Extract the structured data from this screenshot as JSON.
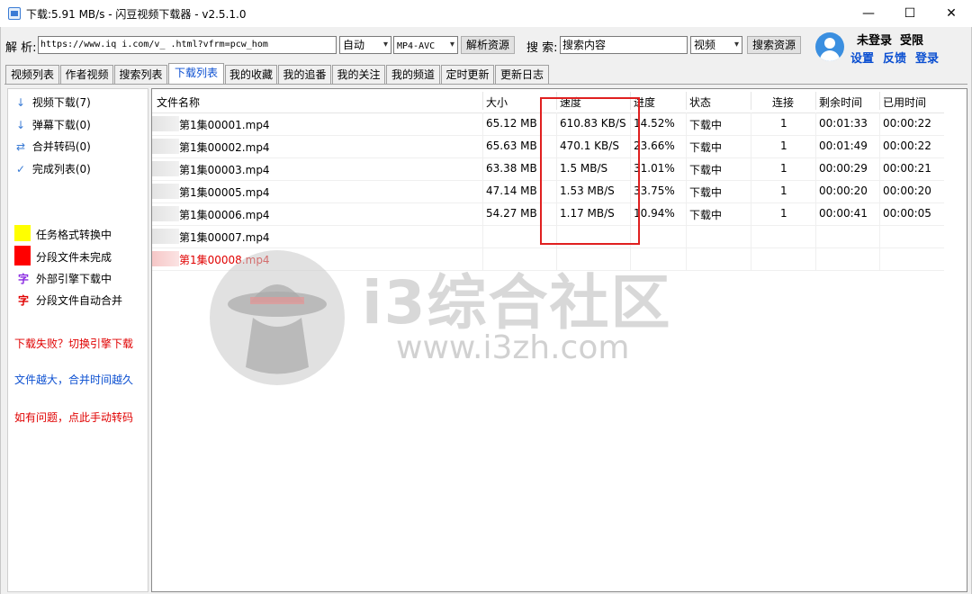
{
  "window": {
    "title": "下载:5.91 MB/s - 闪豆视频下载器 - v2.5.1.0",
    "minimize": "—",
    "maximize": "☐",
    "close": "✕"
  },
  "toolbar": {
    "parse_label": "解 析:",
    "url_value": "https://www.iq   i.com/v_        .html?vfrm=pcw_hom",
    "mode_value": "自动",
    "format_value": "MP4-AVC",
    "parse_button": "解析资源",
    "search_label": "搜 索:",
    "search_value": "搜索内容",
    "search_type": "视频",
    "search_button": "搜索资源"
  },
  "user": {
    "login_status": "未登录",
    "permission": "受限",
    "settings": "设置",
    "feedback": "反馈",
    "login": "登录"
  },
  "tabs": [
    {
      "label": "视频列表"
    },
    {
      "label": "作者视频"
    },
    {
      "label": "搜索列表"
    },
    {
      "label": "下载列表"
    },
    {
      "label": "我的收藏"
    },
    {
      "label": "我的追番"
    },
    {
      "label": "我的关注"
    },
    {
      "label": "我的频道"
    },
    {
      "label": "定时更新"
    },
    {
      "label": "更新日志"
    }
  ],
  "active_tab": "下载列表",
  "sidebar": {
    "items": [
      {
        "icon": "↓",
        "label": "视频下载(7)"
      },
      {
        "icon": "↓",
        "label": "弹幕下载(0)"
      },
      {
        "icon": "⇄",
        "label": "合并转码(0)"
      },
      {
        "icon": "✓",
        "label": "完成列表(0)"
      }
    ],
    "legend": [
      {
        "color": "#ffff00",
        "label": "任务格式转换中"
      },
      {
        "color": "#ff0000",
        "label": "分段文件未完成"
      },
      {
        "glyph": "字",
        "glyph_color": "#8a2be2",
        "label": "外部引擎下载中"
      },
      {
        "glyph": "字",
        "glyph_color": "#e00000",
        "label": "分段文件自动合并"
      }
    ],
    "tips": [
      {
        "text": "下载失败？切换引擎下载",
        "color": "#e00000"
      },
      {
        "text": "文件越大，合并时间越久",
        "color": "#0b4fd1"
      },
      {
        "text": "如有问题，点此手动转码",
        "color": "#e00000"
      }
    ]
  },
  "table": {
    "headers": [
      "文件名称",
      "大小",
      "速度",
      "进度",
      "状态",
      "连接",
      "剩余时间",
      "已用时间"
    ],
    "rows": [
      {
        "name": "第1集00001.mp4",
        "size": "65.12 MB",
        "speed": "610.83 KB/S",
        "progress": "14.52%",
        "status": "下载中",
        "conn": "1",
        "remain": "00:01:33",
        "used": "00:00:22",
        "color": "#000000"
      },
      {
        "name": "第1集00002.mp4",
        "size": "65.63 MB",
        "speed": "470.1 KB/S",
        "progress": "23.66%",
        "status": "下载中",
        "conn": "1",
        "remain": "00:01:49",
        "used": "00:00:22",
        "color": "#000000"
      },
      {
        "name": "第1集00003.mp4",
        "size": "63.38 MB",
        "speed": "1.5 MB/S",
        "progress": "31.01%",
        "status": "下载中",
        "conn": "1",
        "remain": "00:00:29",
        "used": "00:00:21",
        "color": "#000000"
      },
      {
        "name": "第1集00005.mp4",
        "size": "47.14 MB",
        "speed": "1.53 MB/S",
        "progress": "33.75%",
        "status": "下载中",
        "conn": "1",
        "remain": "00:00:20",
        "used": "00:00:20",
        "color": "#000000"
      },
      {
        "name": "第1集00006.mp4",
        "size": "54.27 MB",
        "speed": "1.17 MB/S",
        "progress": "10.94%",
        "status": "下载中",
        "conn": "1",
        "remain": "00:00:41",
        "used": "00:00:05",
        "color": "#000000"
      },
      {
        "name": "第1集00007.mp4",
        "size": "",
        "speed": "",
        "progress": "",
        "status": "",
        "conn": "",
        "remain": "",
        "used": "",
        "color": "#000000"
      },
      {
        "name": "第1集00008.mp4",
        "size": "",
        "speed": "",
        "progress": "",
        "status": "",
        "conn": "",
        "remain": "",
        "used": "",
        "color": "#e00000"
      }
    ]
  },
  "watermark": {
    "name": "i3综合社区",
    "url": "www.i3zh.com"
  }
}
